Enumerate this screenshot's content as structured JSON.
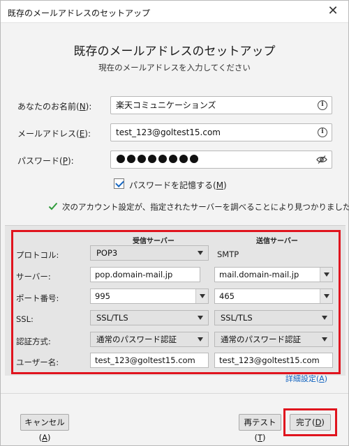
{
  "window": {
    "title": "既存のメールアドレスのセットアップ",
    "close_glyph": "✕"
  },
  "dialog": {
    "title": "既存のメールアドレスのセットアップ",
    "subtitle": "現在のメールアドレスを入力してください"
  },
  "form": {
    "name": {
      "label_pre": "あなたのお名前(",
      "label_key": "N",
      "label_post": "):",
      "value": "楽天コミュニケーションズ"
    },
    "email": {
      "label_pre": "メールアドレス(",
      "label_key": "E",
      "label_post": "):",
      "value": "test_123@goltest15.com"
    },
    "password": {
      "label_pre": "パスワード(",
      "label_key": "P",
      "label_post": "):",
      "masked_count": 8
    },
    "remember": {
      "label_pre": "パスワードを記憶する(",
      "label_key": "M",
      "label_post": ")",
      "checked": true
    },
    "found_message": "次のアカウント設定が、指定されたサーバーを調べることにより見つかりました。"
  },
  "server": {
    "incoming_header": "受信サーバー",
    "outgoing_header": "送信サーバー",
    "rows": {
      "protocol": {
        "label": "プロトコル:",
        "incoming": "POP3",
        "outgoing": "SMTP"
      },
      "server": {
        "label": "サーバー:",
        "incoming": "pop.domain-mail.jp",
        "outgoing": "mail.domain-mail.jp"
      },
      "port": {
        "label": "ポート番号:",
        "incoming": "995",
        "outgoing": "465"
      },
      "ssl": {
        "label": "SSL:",
        "incoming": "SSL/TLS",
        "outgoing": "SSL/TLS"
      },
      "auth": {
        "label": "認証方式:",
        "incoming": "通常のパスワード認証",
        "outgoing": "通常のパスワード認証"
      },
      "username": {
        "label": "ユーザー名:",
        "incoming": "test_123@goltest15.com",
        "outgoing": "test_123@goltest15.com"
      }
    },
    "advanced_pre": "詳細設定(",
    "advanced_key": "A",
    "advanced_post": ")"
  },
  "buttons": {
    "cancel": {
      "pre": "キャンセル(",
      "key": "A",
      "post": ")"
    },
    "retest": {
      "pre": "再テスト(",
      "key": "T",
      "post": ")"
    },
    "done": {
      "pre": "完了(",
      "key": "D",
      "post": ")"
    }
  },
  "colors": {
    "highlight_red": "#e0141e",
    "link_blue": "#1565c0",
    "check_green": "#2e9b3a"
  }
}
